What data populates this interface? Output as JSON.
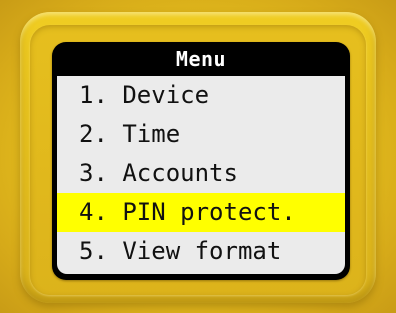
{
  "menu": {
    "title": "Menu",
    "items": [
      {
        "label": "1. Device",
        "selected": false
      },
      {
        "label": "2. Time",
        "selected": false
      },
      {
        "label": "3. Accounts",
        "selected": false
      },
      {
        "label": "4. PIN protect.",
        "selected": true
      },
      {
        "label": "5. View format",
        "selected": false
      }
    ]
  },
  "colors": {
    "housing": "#e2bb1d",
    "screen_frame": "#000000",
    "screen_background": "#ebebeb",
    "highlight": "#ffff00",
    "title_text": "#ffffff",
    "item_text": "#111111"
  }
}
